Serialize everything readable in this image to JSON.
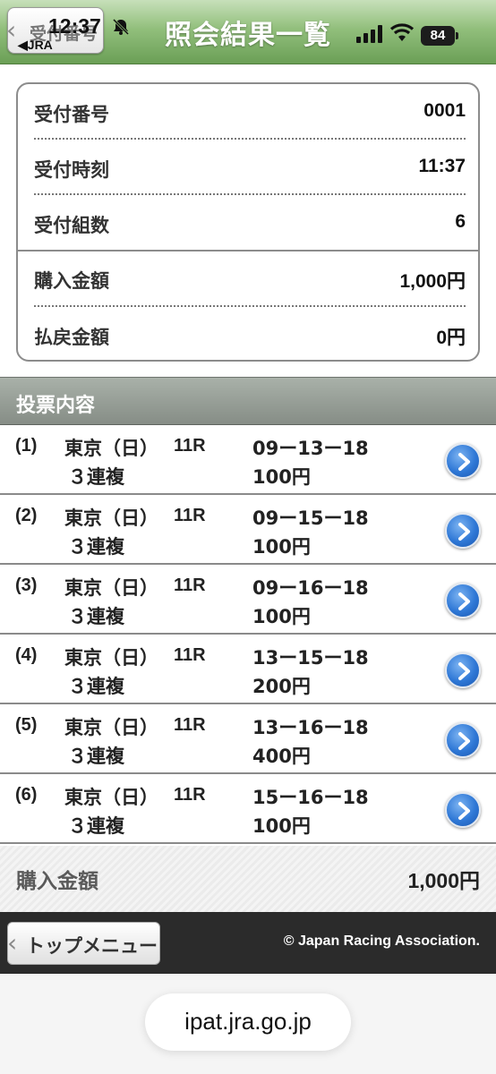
{
  "status_bar": {
    "time": "12:37",
    "jra": "JRA",
    "battery": "84"
  },
  "header": {
    "back_label": "受付番号",
    "title": "照会結果一覧"
  },
  "summary": {
    "rows": [
      {
        "label": "受付番号",
        "value": "0001"
      },
      {
        "label": "受付時刻",
        "value": "11:37"
      },
      {
        "label": "受付組数",
        "value": "6"
      },
      {
        "label": "購入金額",
        "value": "1,000円"
      },
      {
        "label": "払戻金額",
        "value": "0円"
      }
    ]
  },
  "section": {
    "title": "投票内容"
  },
  "bets": [
    {
      "no": "(1)",
      "venue": "東京（日）",
      "race": "11R",
      "type": "３連複",
      "combo": "09ー13ー18",
      "amount": "100円"
    },
    {
      "no": "(2)",
      "venue": "東京（日）",
      "race": "11R",
      "type": "３連複",
      "combo": "09ー15ー18",
      "amount": "100円"
    },
    {
      "no": "(3)",
      "venue": "東京（日）",
      "race": "11R",
      "type": "３連複",
      "combo": "09ー16ー18",
      "amount": "100円"
    },
    {
      "no": "(4)",
      "venue": "東京（日）",
      "race": "11R",
      "type": "３連複",
      "combo": "13ー15ー18",
      "amount": "200円"
    },
    {
      "no": "(5)",
      "venue": "東京（日）",
      "race": "11R",
      "type": "３連複",
      "combo": "13ー16ー18",
      "amount": "400円"
    },
    {
      "no": "(6)",
      "venue": "東京（日）",
      "race": "11R",
      "type": "３連複",
      "combo": "15ー16ー18",
      "amount": "100円"
    }
  ],
  "total": {
    "label": "購入金額",
    "value": "1,000円"
  },
  "footer": {
    "top_menu_label": "トップメニュー",
    "copyright": "© Japan Racing Association."
  },
  "browser": {
    "url": "ipat.jra.go.jp"
  },
  "colors": {
    "header_green": "#7aa866",
    "section_gray": "#969e96",
    "detail_blue": "#2f78d6",
    "footer_dark": "#2b2b2b"
  }
}
